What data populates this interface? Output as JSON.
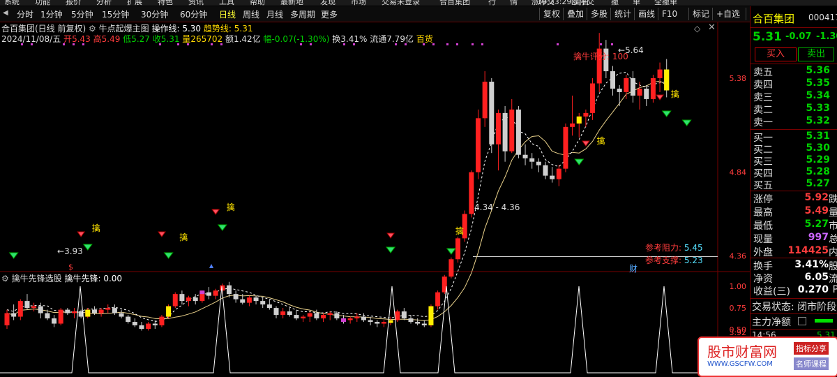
{
  "top_menu": [
    "系统",
    "功能",
    "报价",
    "分析",
    "扩展",
    "特色",
    "资讯",
    "工具",
    "帮助",
    "最新地",
    "发现",
    "市场",
    "交易未登录",
    "合百集团",
    "行",
    "情",
    "涨停交",
    "欧停交",
    "撤",
    "单",
    "全撤单"
  ],
  "time": "10:33:29 周日",
  "tabs": {
    "items": [
      "分时",
      "1分钟",
      "5分钟",
      "15分钟",
      "30分钟",
      "60分钟",
      "日线",
      "周线",
      "月线",
      "多周期",
      "更多"
    ],
    "active": "日线"
  },
  "tool_buttons": [
    "复权",
    "叠加",
    "多股",
    "统计",
    "画线",
    "F10",
    "标记",
    "+自选",
    "返回"
  ],
  "stock_header": {
    "title": "合百集团(日线 前复权)",
    "indicator": "牛点起爆主图",
    "op_line_label": "操作线:",
    "op_line_value": "5.30",
    "trend_label": "趋势线:",
    "trend_value": "5.31"
  },
  "ohlc": {
    "date": "2024/11/08/五",
    "open_label": "开",
    "open": "5.43",
    "high_label": "高",
    "high": "5.49",
    "low_label": "低",
    "low": "5.27",
    "close_label": "收",
    "close": "5.31",
    "vol_label": "量",
    "vol": "265702",
    "amt_label": "额",
    "amt": "1.42亿",
    "chg_label": "幅",
    "chg": "-0.07(-1.30%)",
    "turn_label": "换",
    "turn": "3.41%",
    "float_label": "流通",
    "float": "7.79亿",
    "sector": "百货"
  },
  "annotations": {
    "score_label": "擒牛评分:",
    "score_value": "100",
    "peak_label": "5.64",
    "low_label": "3.93",
    "mid_label": "4.34 - 4.36",
    "resist_label": "参考阻力:",
    "resist_value": "5.45",
    "support_label": "参考支撑:",
    "support_value": "5.23",
    "fin_mark": "财",
    "s_mark": "$",
    "qin": "擒"
  },
  "price_axis": [
    "5.38",
    "4.84",
    "4.36",
    "3.92"
  ],
  "sub_chart": {
    "title": "擒牛先锋选股",
    "series_label": "擒牛先锋:",
    "series_value": "0.00",
    "axis": [
      "1.00",
      "0.75",
      "0.50"
    ]
  },
  "right_panel": {
    "name": "合百集团",
    "code": "000417",
    "price": "5.31",
    "change": "-0.07",
    "pct": "-1.30%",
    "buy_btn": "买入",
    "sell_btn": "卖出",
    "asks": [
      {
        "label": "卖五",
        "price": "5.36"
      },
      {
        "label": "卖四",
        "price": "5.35"
      },
      {
        "label": "卖三",
        "price": "5.34"
      },
      {
        "label": "卖二",
        "price": "5.33"
      },
      {
        "label": "卖一",
        "price": "5.32"
      }
    ],
    "bids": [
      {
        "label": "买一",
        "price": "5.31"
      },
      {
        "label": "买二",
        "price": "5.30"
      },
      {
        "label": "买三",
        "price": "5.29"
      },
      {
        "label": "买四",
        "price": "5.28"
      },
      {
        "label": "买五",
        "price": "5.27"
      }
    ],
    "stats": [
      {
        "label": "涨停",
        "value": "5.92",
        "color": "#ff3c3c",
        "suffix": "跌"
      },
      {
        "label": "最高",
        "value": "5.49",
        "color": "#ff3c3c",
        "suffix": "量"
      },
      {
        "label": "最低",
        "value": "5.27",
        "color": "#00d000",
        "suffix": "市"
      },
      {
        "label": "现量",
        "value": "997",
        "color": "#cc66ff",
        "suffix": "总"
      },
      {
        "label": "外盘",
        "value": "114425",
        "color": "#ff3c3c",
        "suffix": "内"
      }
    ],
    "stats2": [
      {
        "label": "换手",
        "value": "3.41%",
        "suffix": "股"
      },
      {
        "label": "净资",
        "value": "6.05",
        "suffix": "流"
      },
      {
        "label": "收益(三)",
        "value": "0.270",
        "suffix": "P"
      }
    ],
    "trade_status": "交易状态: 闭市阶段",
    "net_label": "主力净额",
    "tick_time": "14:56",
    "tick_price": "5.31"
  },
  "watermark": {
    "title": "股市财富网",
    "tag1": "指标分享",
    "tag2": "名师课程",
    "url": "WWW.GSCFW.COM"
  },
  "chart_data": {
    "type": "candlestick",
    "candles": [
      [
        3.96,
        4.05,
        3.94,
        4.03
      ],
      [
        4.03,
        4.08,
        3.99,
        4.01
      ],
      [
        4.01,
        4.11,
        3.99,
        4.1
      ],
      [
        4.1,
        4.14,
        4.05,
        4.06
      ],
      [
        4.06,
        4.09,
        4.04,
        4.07
      ],
      [
        4.07,
        4.09,
        4.0,
        4.03
      ],
      [
        4.03,
        4.05,
        3.99,
        4.0
      ],
      [
        4.0,
        4.02,
        3.95,
        3.97
      ],
      [
        3.97,
        4.06,
        3.96,
        4.05
      ],
      [
        4.05,
        4.06,
        4.02,
        4.03
      ],
      [
        4.03,
        4.06,
        4.0,
        4.04
      ],
      [
        4.04,
        4.05,
        4.0,
        4.01
      ],
      [
        4.01,
        4.06,
        4.0,
        4.05
      ],
      [
        4.05,
        4.07,
        4.02,
        4.03
      ],
      [
        4.03,
        4.06,
        4.01,
        4.05
      ],
      [
        4.05,
        4.08,
        4.03,
        4.06
      ],
      [
        4.06,
        4.08,
        4.02,
        4.03
      ],
      [
        4.03,
        4.05,
        4.0,
        4.01
      ],
      [
        4.01,
        4.02,
        3.97,
        3.98
      ],
      [
        3.98,
        4.0,
        3.95,
        3.96
      ],
      [
        3.96,
        3.98,
        3.93,
        3.94
      ],
      [
        3.94,
        3.98,
        3.93,
        3.97
      ],
      [
        3.97,
        3.99,
        3.94,
        3.96
      ],
      [
        3.96,
        4.02,
        3.95,
        4.01
      ],
      [
        4.01,
        4.08,
        4.0,
        4.07
      ],
      [
        4.07,
        4.15,
        4.06,
        4.14
      ],
      [
        4.14,
        4.16,
        4.08,
        4.1
      ],
      [
        4.1,
        4.13,
        4.07,
        4.12
      ],
      [
        4.12,
        4.14,
        4.08,
        4.1
      ],
      [
        4.1,
        4.16,
        4.09,
        4.15
      ],
      [
        4.15,
        4.18,
        4.11,
        4.13
      ],
      [
        4.13,
        4.17,
        4.11,
        4.16
      ],
      [
        4.16,
        4.2,
        4.14,
        4.19
      ],
      [
        4.19,
        4.21,
        4.12,
        4.14
      ],
      [
        4.14,
        4.16,
        4.09,
        4.11
      ],
      [
        4.11,
        4.14,
        4.08,
        4.09
      ],
      [
        4.09,
        4.13,
        4.07,
        4.12
      ],
      [
        4.12,
        4.13,
        4.08,
        4.1
      ],
      [
        4.1,
        4.12,
        4.06,
        4.08
      ],
      [
        4.08,
        4.11,
        4.05,
        4.06
      ],
      [
        4.06,
        4.07,
        4.0,
        4.02
      ],
      [
        4.02,
        4.06,
        4.0,
        4.04
      ],
      [
        4.04,
        4.06,
        4.01,
        4.02
      ],
      [
        4.02,
        4.05,
        3.99,
        4.0
      ],
      [
        4.0,
        4.02,
        3.98,
        4.01
      ],
      [
        4.01,
        4.04,
        3.98,
        4.03
      ],
      [
        4.03,
        4.05,
        3.99,
        4.0
      ],
      [
        4.0,
        4.03,
        3.98,
        4.02
      ],
      [
        4.02,
        4.04,
        3.99,
        4.03
      ],
      [
        4.03,
        4.04,
        3.99,
        4.0
      ],
      [
        4.0,
        4.02,
        3.97,
        3.99
      ],
      [
        3.99,
        4.01,
        3.97,
        4.0
      ],
      [
        4.0,
        4.03,
        3.98,
        4.01
      ],
      [
        4.01,
        4.03,
        3.98,
        3.99
      ],
      [
        3.99,
        4.01,
        3.96,
        3.98
      ],
      [
        3.98,
        3.99,
        3.95,
        3.97
      ],
      [
        3.97,
        3.99,
        3.95,
        3.98
      ],
      [
        3.98,
        4.01,
        3.96,
        3.99
      ],
      [
        3.99,
        4.05,
        3.98,
        4.04
      ],
      [
        4.04,
        4.06,
        3.99,
        4.0
      ],
      [
        4.0,
        4.02,
        3.97,
        3.98
      ],
      [
        3.98,
        4.0,
        3.96,
        3.97
      ],
      [
        3.97,
        3.99,
        3.95,
        3.96
      ],
      [
        3.96,
        4.08,
        3.95,
        4.07
      ],
      [
        4.07,
        4.16,
        4.05,
        4.15
      ],
      [
        4.15,
        4.25,
        4.14,
        4.24
      ],
      [
        4.24,
        4.35,
        4.23,
        4.34
      ],
      [
        4.34,
        4.47,
        4.32,
        4.46
      ],
      [
        4.46,
        4.62,
        4.44,
        4.6
      ],
      [
        4.6,
        4.85,
        4.58,
        4.84
      ],
      [
        4.84,
        5.2,
        4.8,
        5.15
      ],
      [
        5.15,
        5.42,
        5.1,
        5.36
      ],
      [
        5.36,
        5.38,
        4.95,
        5.0
      ],
      [
        5.0,
        5.2,
        4.85,
        5.18
      ],
      [
        5.18,
        5.22,
        4.9,
        4.96
      ],
      [
        4.96,
        5.26,
        4.95,
        5.2
      ],
      [
        5.2,
        5.22,
        4.92,
        4.94
      ],
      [
        4.94,
        5.0,
        4.88,
        4.92
      ],
      [
        4.92,
        4.95,
        4.86,
        4.9
      ],
      [
        4.9,
        4.92,
        4.84,
        4.88
      ],
      [
        4.88,
        4.9,
        4.8,
        4.82
      ],
      [
        4.82,
        4.87,
        4.78,
        4.8
      ],
      [
        4.8,
        4.88,
        4.76,
        4.86
      ],
      [
        4.86,
        5.12,
        4.84,
        5.1
      ],
      [
        5.1,
        5.28,
        5.05,
        5.12
      ],
      [
        5.12,
        5.18,
        5.04,
        5.16
      ],
      [
        5.16,
        5.2,
        5.1,
        5.18
      ],
      [
        5.18,
        5.38,
        5.14,
        5.35
      ],
      [
        5.35,
        5.64,
        5.3,
        5.55
      ],
      [
        5.55,
        5.6,
        5.38,
        5.42
      ],
      [
        5.42,
        5.45,
        5.28,
        5.32
      ],
      [
        5.32,
        5.34,
        5.22,
        5.3
      ],
      [
        5.3,
        5.4,
        5.26,
        5.38
      ],
      [
        5.38,
        5.42,
        5.24,
        5.28
      ],
      [
        5.28,
        5.36,
        5.2,
        5.32
      ],
      [
        5.32,
        5.34,
        5.22,
        5.26
      ],
      [
        5.26,
        5.4,
        5.24,
        5.38
      ],
      [
        5.38,
        5.47,
        5.3,
        5.43
      ],
      [
        5.43,
        5.49,
        5.27,
        5.31
      ]
    ],
    "price_axis": [
      5.38,
      4.84,
      4.36,
      3.92
    ],
    "signal_ticks": [
      9,
      27,
      41,
      71,
      87,
      97
    ]
  }
}
